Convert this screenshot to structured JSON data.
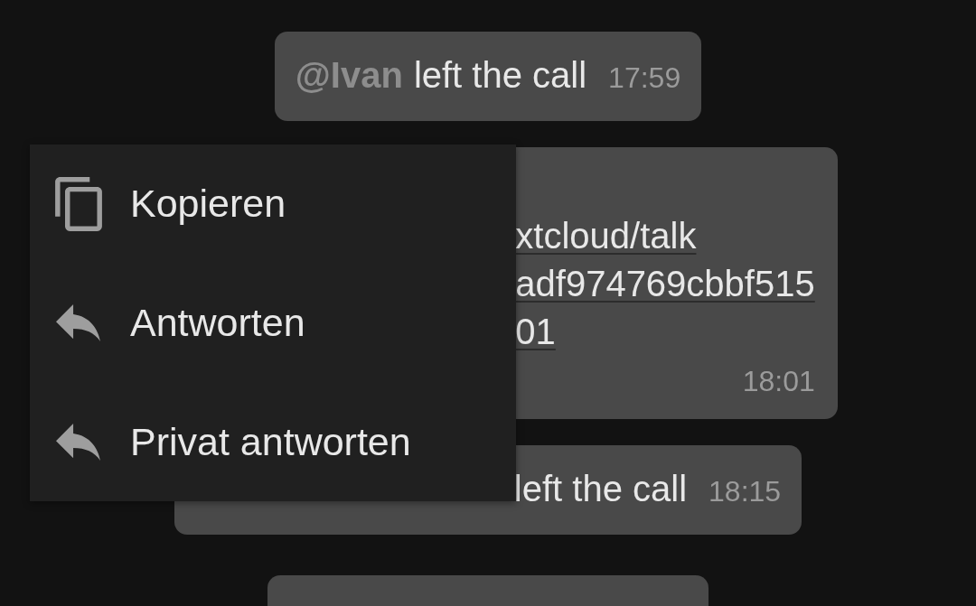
{
  "messages": [
    {
      "kind": "system",
      "author": "@Ivan",
      "text": "left the call",
      "time": "17:59"
    },
    {
      "kind": "link",
      "link_lines": [
        "xtcloud/talk",
        "adf974769cbbf515",
        "01"
      ],
      "time": "18:01"
    },
    {
      "kind": "system",
      "text": "left the call",
      "time": "18:15"
    },
    {
      "kind": "system"
    }
  ],
  "context_menu": {
    "items": [
      {
        "kind": "copy",
        "label": "Kopieren"
      },
      {
        "kind": "reply",
        "label": "Antworten"
      },
      {
        "kind": "reply",
        "label": "Privat antworten"
      }
    ]
  }
}
